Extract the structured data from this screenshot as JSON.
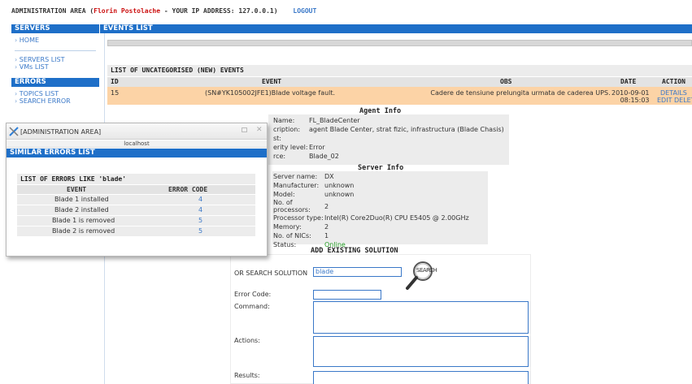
{
  "header": {
    "admin_label": "ADMINISTRATION AREA (",
    "user": "Florin Postolache",
    "ip_text": " - YOUR IP ADDRESS: 127.0.0.1)",
    "logout": "LOGOUT"
  },
  "sidebar": {
    "servers_title": "SERVERS",
    "home": "HOME",
    "servers_list": "SERVERS LIST",
    "vms_list": "VMs LIST",
    "errors_title": "ERRORS",
    "topics_list": "TOPICS LIST",
    "search_error": "SEARCH ERROR"
  },
  "main": {
    "title": "EVENTS LIST",
    "table_title": "LIST OF UNCATEGORISED (NEW) EVENTS",
    "columns": [
      "ID",
      "EVENT",
      "OBS",
      "DATE",
      "ACTION"
    ],
    "row": {
      "id": "15",
      "event": "(SN#YK105002JFE1)Blade voltage fault.",
      "obs": "Cadere de tensiune prelungita urmata de caderea UPS.",
      "date_1": "2010-09-01",
      "date_2": "08:15:03",
      "action_details": "DETAILS",
      "action_edit": "EDIT",
      "action_delete": "DELETE"
    }
  },
  "agent": {
    "title": "Agent Info",
    "rows": [
      {
        "k": "Name:",
        "v": "FL_BladeCenter"
      },
      {
        "k": "cription:",
        "v": "agent Blade Center, strat fizic, infrastructura (Blade Chasis)"
      },
      {
        "k": "st:",
        "v": ""
      },
      {
        "k": "erity level:",
        "v": "Error"
      },
      {
        "k": "rce:",
        "v": "Blade_02"
      }
    ]
  },
  "server": {
    "title": "Server Info",
    "rows": [
      {
        "k": "Server name:",
        "v": "DX"
      },
      {
        "k": "Manufacturer:",
        "v": "unknown"
      },
      {
        "k": "Model:",
        "v": "unknown"
      },
      {
        "k": "No. of processors:",
        "v": "2"
      },
      {
        "k": "Processor type:",
        "v": "Intel(R) Core2Duo(R) CPU E5405 @ 2.00GHz"
      },
      {
        "k": "Memory:",
        "v": "2"
      },
      {
        "k": "No. of NICs:",
        "v": "1"
      },
      {
        "k": "Status:",
        "v": "Online"
      }
    ],
    "status_color": "#1f9a1f"
  },
  "solution": {
    "title": "ADD EXISTING SOLUTION",
    "search_label": "OR SEARCH SOLUTION",
    "search_value": "blade",
    "search_button": "SEARCH",
    "error_code_label": "Error Code:",
    "command_label": "Command:",
    "actions_label": "Actions:",
    "results_label": "Results:"
  },
  "popup": {
    "window_title": "[ADMINISTRATION AREA]",
    "host": "localhost",
    "header": "SIMILAR ERRORS LIST",
    "list_title": "LIST OF ERRORS LIKE 'blade'",
    "col_event": "EVENT",
    "col_code": "ERROR CODE",
    "rows": [
      {
        "event": "Blade 1 installed",
        "code": "4"
      },
      {
        "event": "Blade 2 installed",
        "code": "4"
      },
      {
        "event": "Blade 1 is removed",
        "code": "5"
      },
      {
        "event": "Blade 2 is removed",
        "code": "5"
      }
    ]
  },
  "colors": {
    "accent_blue": "#1e6fc8",
    "row_highlight": "#fcd3a6",
    "user_red": "#cc1111"
  }
}
